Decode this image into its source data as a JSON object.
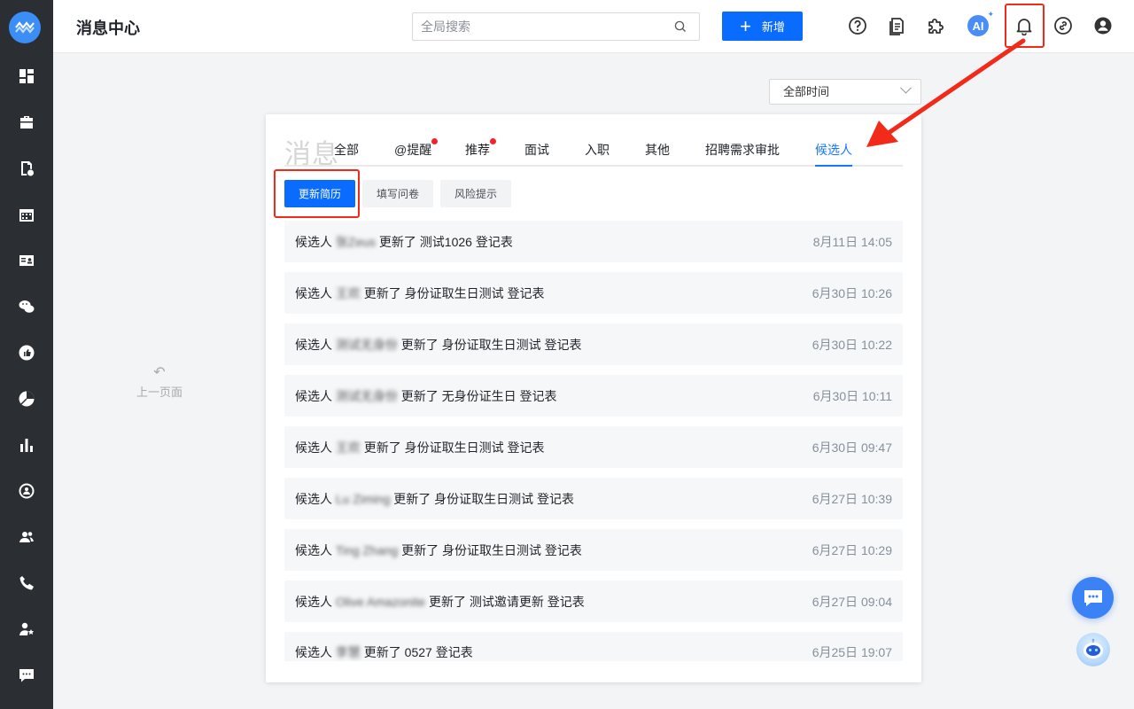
{
  "header": {
    "title": "消息中心",
    "search_placeholder": "全局搜索",
    "add_label": "新增",
    "ai_label": "AI"
  },
  "filter": {
    "time_value": "全部时间"
  },
  "back": {
    "label": "上一页面"
  },
  "panel": {
    "title": "消息",
    "tabs": [
      {
        "label": "全部",
        "dot": false
      },
      {
        "label": "@提醒",
        "dot": true
      },
      {
        "label": "推荐",
        "dot": true
      },
      {
        "label": "面试",
        "dot": false
      },
      {
        "label": "入职",
        "dot": false
      },
      {
        "label": "其他",
        "dot": false
      },
      {
        "label": "招聘需求审批",
        "dot": false
      },
      {
        "label": "候选人",
        "dot": false
      }
    ],
    "active_tab": "候选人",
    "subtabs": [
      {
        "label": "更新简历"
      },
      {
        "label": "填写问卷"
      },
      {
        "label": "风险提示"
      }
    ],
    "active_subtab": "更新简历",
    "messages": [
      {
        "prefix": "候选人",
        "name": "张Zeus",
        "action": "更新了 测试1026 登记表",
        "time": "8月11日 14:05"
      },
      {
        "prefix": "候选人",
        "name": "王欢",
        "action": "更新了 身份证取生日测试 登记表",
        "time": "6月30日 10:26"
      },
      {
        "prefix": "候选人",
        "name": "测试无身份",
        "action": "更新了 身份证取生日测试 登记表",
        "time": "6月30日 10:22"
      },
      {
        "prefix": "候选人",
        "name": "测试无身份",
        "action": "更新了 无身份证生日 登记表",
        "time": "6月30日 10:11"
      },
      {
        "prefix": "候选人",
        "name": "王欢",
        "action": "更新了 身份证取生日测试 登记表",
        "time": "6月30日 09:47"
      },
      {
        "prefix": "候选人",
        "name": "Lu Ziming",
        "action": "更新了 身份证取生日测试 登记表",
        "time": "6月27日 10:39"
      },
      {
        "prefix": "候选人",
        "name": "Ting Zhang",
        "action": "更新了 身份证取生日测试 登记表",
        "time": "6月27日 10:29"
      },
      {
        "prefix": "候选人",
        "name": "Olive Amazonite",
        "action": "更新了 测试邀请更新 登记表",
        "time": "6月27日 09:04"
      },
      {
        "prefix": "候选人",
        "name": "李慧",
        "action": "更新了 0527 登记表",
        "time": "6月25日 19:07"
      }
    ]
  },
  "colors": {
    "sidebar_bg": "#2b2e33",
    "primary": "#0a6cff",
    "active_tab": "#1677ff",
    "annotation_red": "#f22a1a",
    "badge_dot": "#f5222d"
  },
  "icons": {
    "sidebar": [
      "dashboard-icon",
      "briefcase-icon",
      "resume-icon",
      "calendar-icon",
      "id-card-icon",
      "wechat-icon",
      "thumbs-up-icon",
      "pie-chart-icon",
      "bar-chart-icon",
      "person-circle-icon",
      "group-icon",
      "phone-icon",
      "user-star-icon",
      "chat-bubble-icon"
    ],
    "header": [
      "help-icon",
      "document-icon",
      "puzzle-icon",
      "ai-icon",
      "bell-icon",
      "link-icon",
      "user-icon"
    ]
  }
}
